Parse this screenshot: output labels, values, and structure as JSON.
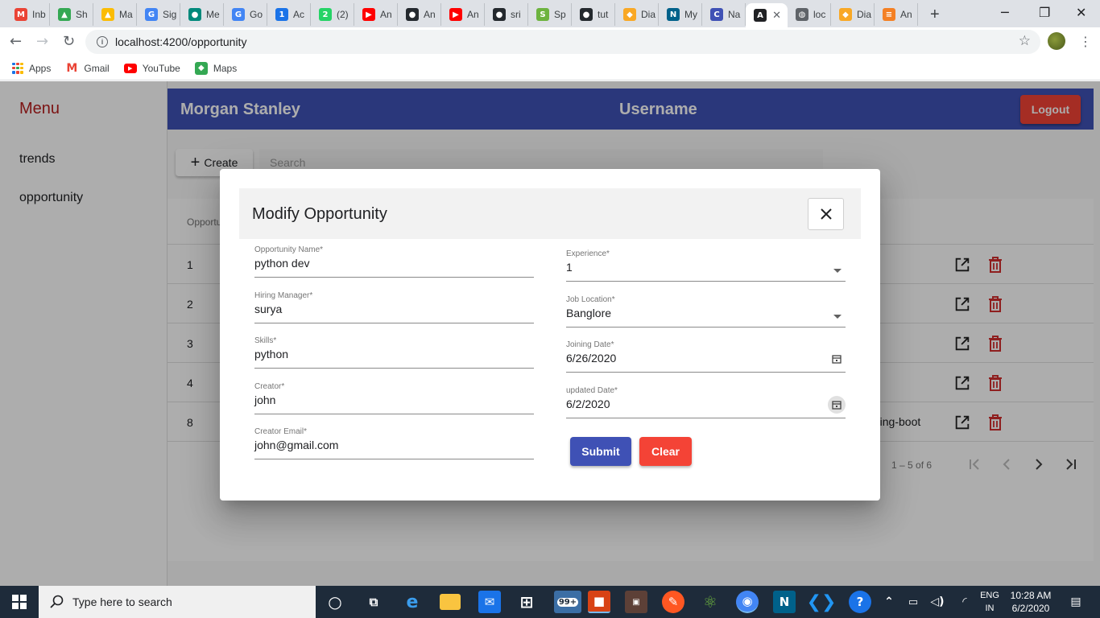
{
  "browser": {
    "tabs": [
      {
        "label": "Inb",
        "icon": "gmail-icon",
        "color": "#ea4335",
        "glyph": "M"
      },
      {
        "label": "Sh",
        "icon": "drive-icon",
        "color": "#34a853",
        "glyph": "▲"
      },
      {
        "label": "Ma",
        "icon": "drive-icon",
        "color": "#fbbc04",
        "glyph": "▲"
      },
      {
        "label": "Sig",
        "icon": "google-icon",
        "color": "#4285f4",
        "glyph": "G"
      },
      {
        "label": "Me",
        "icon": "chat-icon",
        "color": "#00897b",
        "glyph": "●"
      },
      {
        "label": "Go",
        "icon": "google-icon",
        "color": "#4285f4",
        "glyph": "G"
      },
      {
        "label": "Ac",
        "icon": "calendar-icon",
        "color": "#1a73e8",
        "glyph": "1"
      },
      {
        "label": "(2)",
        "icon": "whatsapp-icon",
        "color": "#25d366",
        "glyph": "2"
      },
      {
        "label": "An",
        "icon": "youtube-icon",
        "color": "#ff0000",
        "glyph": "▶"
      },
      {
        "label": "An",
        "icon": "github-icon",
        "color": "#24292e",
        "glyph": "●"
      },
      {
        "label": "An",
        "icon": "youtube-icon",
        "color": "#ff0000",
        "glyph": "▶"
      },
      {
        "label": "sri",
        "icon": "github-icon",
        "color": "#24292e",
        "glyph": "●"
      },
      {
        "label": "Sp",
        "icon": "spring-icon",
        "color": "#6db33f",
        "glyph": "S"
      },
      {
        "label": "tut",
        "icon": "github-icon",
        "color": "#24292e",
        "glyph": "●"
      },
      {
        "label": "Dia",
        "icon": "shield-icon",
        "color": "#f9a825",
        "glyph": "◆"
      },
      {
        "label": "My",
        "icon": "mysql-icon",
        "color": "#00618a",
        "glyph": "N"
      },
      {
        "label": "Na",
        "icon": "c-icon",
        "color": "#3f51b5",
        "glyph": "C"
      },
      {
        "label": "",
        "icon": "angular-icon",
        "color": "#202124",
        "glyph": "A",
        "active": true
      },
      {
        "label": "loc",
        "icon": "globe-icon",
        "color": "#5f6368",
        "glyph": "◍"
      },
      {
        "label": "Dia",
        "icon": "shield-icon",
        "color": "#f9a825",
        "glyph": "◆"
      },
      {
        "label": "An",
        "icon": "stack-icon",
        "color": "#f48024",
        "glyph": "≡"
      }
    ],
    "url": "localhost:4200/opportunity",
    "bookmarks": [
      {
        "label": "Apps",
        "icon": "apps-grid-icon"
      },
      {
        "label": "Gmail",
        "icon": "gmail-icon"
      },
      {
        "label": "YouTube",
        "icon": "youtube-icon"
      },
      {
        "label": "Maps",
        "icon": "maps-icon"
      }
    ]
  },
  "sidebar": {
    "title": "Menu",
    "items": [
      "trends",
      "opportunity"
    ]
  },
  "header": {
    "brand": "Morgan Stanley",
    "username": "Username",
    "logout": "Logout"
  },
  "toolbar": {
    "create_label": "Create",
    "search_placeholder": "Search"
  },
  "table": {
    "header_first": "Opportu",
    "rows": [
      {
        "id": "1",
        "extra": ""
      },
      {
        "id": "2",
        "extra": ""
      },
      {
        "id": "3",
        "extra": ""
      },
      {
        "id": "4",
        "extra": ""
      },
      {
        "id": "8",
        "extra": "ring-boot"
      }
    ],
    "range": "1 – 5 of 6"
  },
  "dialog": {
    "title": "Modify Opportunity",
    "fields_left": [
      {
        "label": "Opportunity Name*",
        "value": "python dev"
      },
      {
        "label": "Hiring Manager*",
        "value": "surya"
      },
      {
        "label": "Skills*",
        "value": "python"
      },
      {
        "label": "Creator*",
        "value": "john"
      },
      {
        "label": "Creator Email*",
        "value": "john@gmail.com"
      }
    ],
    "fields_right": [
      {
        "label": "Experience*",
        "value": "1",
        "kind": "select"
      },
      {
        "label": "Job Location*",
        "value": "Banglore",
        "kind": "select"
      },
      {
        "label": "Joining Date*",
        "value": "6/26/2020",
        "kind": "date"
      },
      {
        "label": "updated Date*",
        "value": "6/2/2020",
        "kind": "date"
      }
    ],
    "submit": "Submit",
    "clear": "Clear"
  },
  "taskbar": {
    "search_placeholder": "Type here to search",
    "badge": "99+",
    "lang_top": "ENG",
    "lang_bottom": "IN",
    "time": "10:28 AM",
    "date": "6/2/2020"
  }
}
